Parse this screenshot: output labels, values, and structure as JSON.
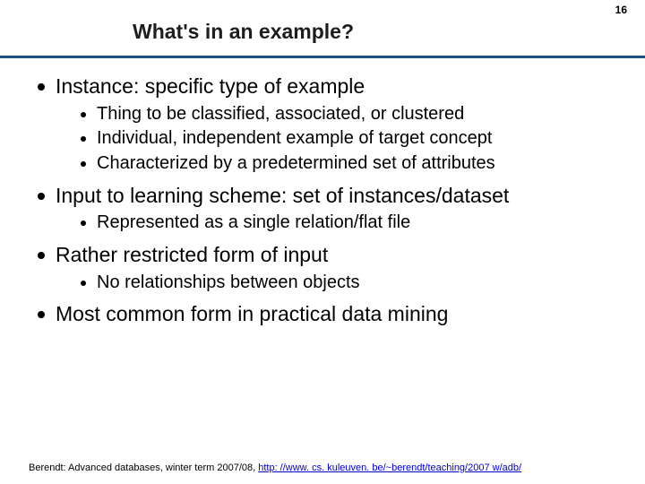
{
  "page_number": "16",
  "title": "What's in an example?",
  "bullets": [
    {
      "text": "Instance: specific type of example",
      "sub": [
        "Thing to be classified, associated, or clustered",
        "Individual, independent example of target concept",
        "Characterized by a predetermined set of attributes"
      ]
    },
    {
      "text": "Input to learning scheme: set of instances/dataset",
      "sub": [
        "Represented as a single relation/flat file"
      ]
    },
    {
      "text": "Rather restricted form of input",
      "sub": [
        "No relationships between objects"
      ]
    },
    {
      "text": "Most common form in practical data mining",
      "sub": []
    }
  ],
  "footer_prefix": "Berendt: Advanced databases, winter term 2007/08, ",
  "footer_link": "http: //www. cs. kuleuven. be/~berendt/teaching/2007 w/adb/"
}
